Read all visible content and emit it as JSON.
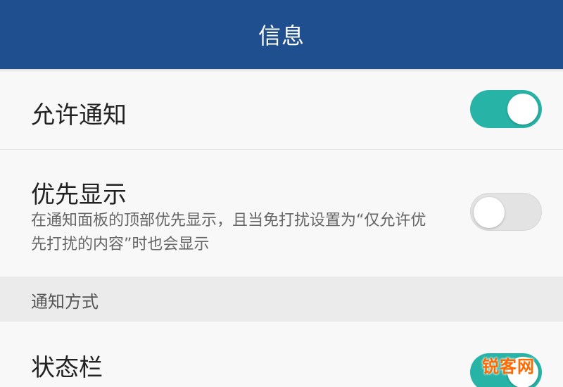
{
  "header": {
    "title": "信息",
    "background": "#1f4f8f"
  },
  "settings": {
    "allow_notifications": {
      "label": "允许通知",
      "toggle": "on"
    },
    "priority_display": {
      "label": "优先显示",
      "description": "在通知面板的顶部优先显示，且当免打扰设置为“仅允许优先打扰的内容”时也会显示",
      "toggle": "off"
    },
    "section_notification_method": {
      "label": "通知方式"
    },
    "status_bar": {
      "label": "状态栏",
      "toggle": "on"
    }
  },
  "colors": {
    "toggle_on": "#27b3a6",
    "toggle_off": "#e3e3e3"
  },
  "watermark": "锐客网"
}
